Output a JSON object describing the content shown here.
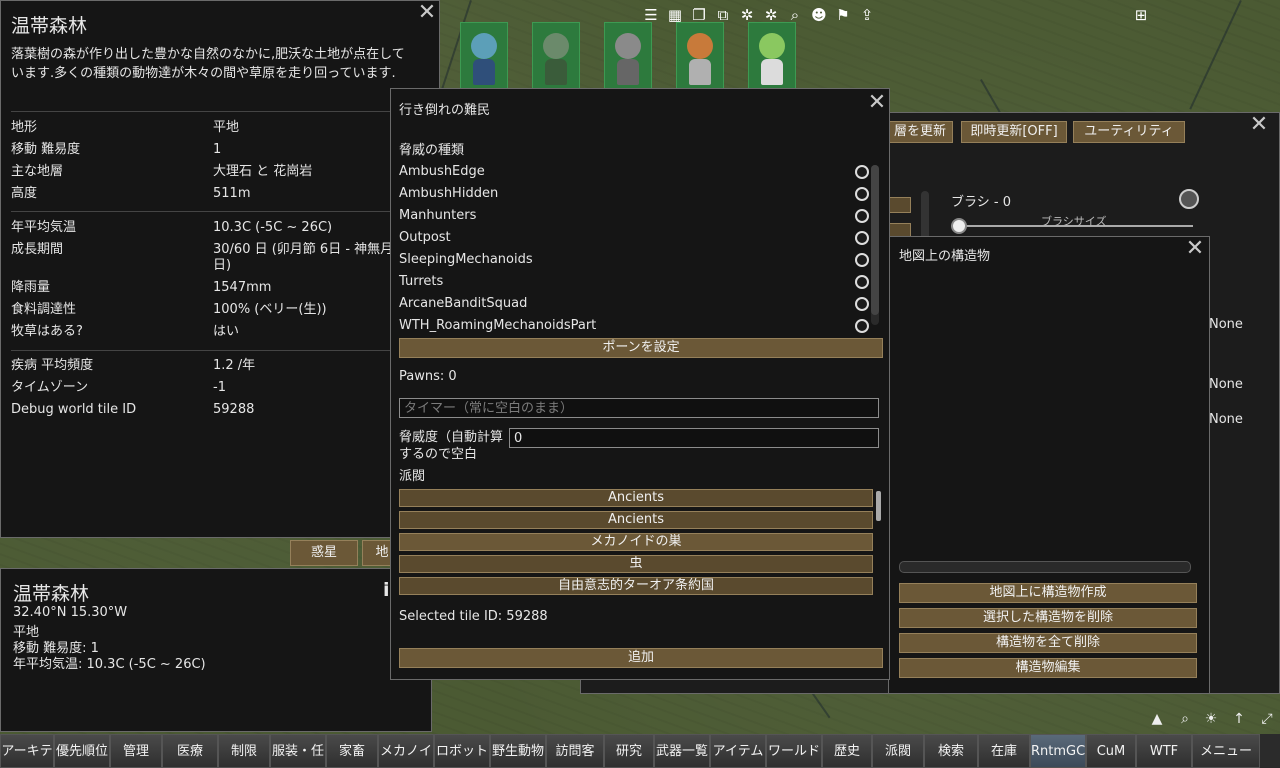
{
  "tile_panel": {
    "title": "温帯森林",
    "description": "落葉樹の森が作り出した豊かな自然のなかに,肥沃な土地が点在しています.多くの種類の動物達が木々の間や草原を走り回っています.",
    "rows1": [
      {
        "k": "地形",
        "v": "平地"
      },
      {
        "k": "移動 難易度",
        "v": "1"
      },
      {
        "k": "主な地層",
        "v": "大理石 と 花崗岩"
      },
      {
        "k": "高度",
        "v": "511m"
      }
    ],
    "rows2": [
      {
        "k": "年平均気温",
        "v": "10.3C (-5C ~ 26C)"
      },
      {
        "k": "成長期間",
        "v": "30/60 日 (卯月節 6日 - 神無月 6日)"
      },
      {
        "k": "降雨量",
        "v": "1547mm"
      },
      {
        "k": "食料調達性",
        "v": "100% (ベリー(生))"
      },
      {
        "k": "牧草はある?",
        "v": "はい"
      }
    ],
    "rows3": [
      {
        "k": "疾病 平均頻度",
        "v": "1.2 /年"
      },
      {
        "k": "タイムゾーン",
        "v": "-1"
      },
      {
        "k": "Debug world tile ID",
        "v": "59288"
      }
    ],
    "planet_button": "惑星",
    "other_button": "地"
  },
  "summary_panel": {
    "title": "温帯森林",
    "coords": "32.40°N 15.30°W",
    "terrain": "平地",
    "movement": "移動 難易度: 1",
    "temp": "年平均気温: 10.3C (-5C ~ 26C)",
    "info_icon": "i"
  },
  "threat_dialog": {
    "title": "行き倒れの難民",
    "threat_type_label": "脅威の種類",
    "threat_types": [
      "AmbushEdge",
      "AmbushHidden",
      "Manhunters",
      "Outpost",
      "SleepingMechanoids",
      "Turrets",
      "ArcaneBanditSquad",
      "WTH_RoamingMechanoidsPart"
    ],
    "set_pawn_button": "ポーンを設定",
    "pawns_text": "Pawns: 0",
    "timer_placeholder": "タイマー（常に空白のまま）",
    "threat_label": "脅威度（自動計算するので空白",
    "threat_value": "0",
    "faction_label": "派閥",
    "factions": [
      "Ancients",
      "Ancients",
      "メカノイドの巣",
      "虫",
      "自由意志的ターオア条約国"
    ],
    "selected_tile": "Selected tile ID: 59288",
    "add_button": "追加"
  },
  "editor_panel": {
    "buttons": [
      "層を更新",
      "即時更新[OFF]",
      "ユーティリティ"
    ],
    "brush_label": "ブラシ - 0",
    "brush_size_label": "ブラシサイズ",
    "none_values": [
      "None",
      "None",
      "None"
    ]
  },
  "structures_panel": {
    "title": "地図上の構造物",
    "buttons": [
      "地図上に構造物作成",
      "選択した構造物を削除",
      "構造物を全て削除",
      "構造物編集"
    ]
  },
  "bottom_tabs": [
    "アーキテ",
    "優先順位",
    "管理",
    "医療",
    "制限",
    "服装・任",
    "家畜",
    "メカノイ",
    "ロボット",
    "野生動物",
    "訪問客",
    "研究",
    "武器一覧",
    "アイテム",
    "ワールド",
    "歴史",
    "派閥",
    "検索",
    "在庫",
    "RntmGC",
    "CuM",
    "WTF",
    "メニュー"
  ],
  "colors": {
    "accent_button": "#6b5837",
    "panel_bg": "#151515",
    "map_green": "#4b5a33"
  }
}
